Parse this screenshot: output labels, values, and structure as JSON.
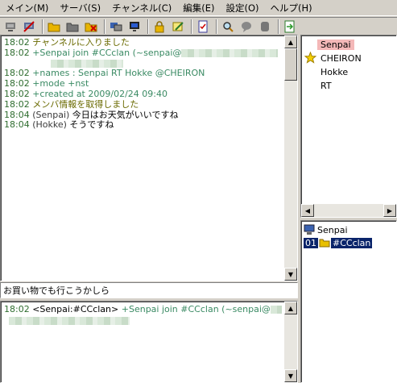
{
  "menu": [
    {
      "label": "メイン(M)"
    },
    {
      "label": "サーバ(S)"
    },
    {
      "label": "チャンネル(C)"
    },
    {
      "label": "編集(E)"
    },
    {
      "label": "設定(O)"
    },
    {
      "label": "ヘルプ(H)"
    }
  ],
  "toolbar": {
    "icons": [
      "connect-icon",
      "disconnect-icon",
      "open-folder-icon",
      "folder-icon",
      "close-folder-icon",
      "server-icon",
      "monitor-icon",
      "lock-icon",
      "edit-icon",
      "checklist-icon",
      "search-icon",
      "chat-bubble-icon",
      "stop-icon",
      "export-icon"
    ]
  },
  "chat": {
    "lines": [
      {
        "time": "18:02",
        "text": "チャンネルに入りました",
        "kind": "sys"
      },
      {
        "time": "18:02",
        "text": "+Senpai join #CCclan (~senpai@",
        "kind": "ev",
        "blurred": true
      },
      {
        "time": "18:02",
        "text": "+names : Senpai RT Hokke @CHEIRON",
        "kind": "ev"
      },
      {
        "time": "18:02",
        "text": "+mode +nst",
        "kind": "ev"
      },
      {
        "time": "18:02",
        "text": "+created at 2009/02/24 09:40",
        "kind": "ev"
      },
      {
        "time": "18:02",
        "text": "メンバ情報を取得しました",
        "kind": "sys"
      },
      {
        "time": "18:04",
        "nick": "(Senpai)",
        "text": "今日はお天気がいいですね",
        "kind": "msg"
      },
      {
        "time": "18:04",
        "nick": "(Hokke)",
        "text": "そうですね",
        "kind": "msg"
      }
    ]
  },
  "input": {
    "value": "お買い物でも行こうかしら"
  },
  "sublog": {
    "time": "18:02",
    "channel": "<Senpai:#CCclan>",
    "text": "+Senpai join #CCclan (~senpai@"
  },
  "nicklist": [
    {
      "name": "Senpai",
      "selected": true,
      "icon": ""
    },
    {
      "name": "CHEIRON",
      "selected": false,
      "icon": "star-icon"
    },
    {
      "name": "Hokke",
      "selected": false,
      "icon": ""
    },
    {
      "name": "RT",
      "selected": false,
      "icon": ""
    }
  ],
  "tree": {
    "server": "Senpai",
    "channel_number": "01",
    "channel_name": "#CCclan"
  },
  "colors": {
    "window_bg": "#d4d0c8",
    "timestamp": "#2f6d2f",
    "system_text": "#6a6a00",
    "event_text": "#3a8a63",
    "selected_nick_bg": "#f4b8b8",
    "selection_blue": "#0a246a"
  }
}
